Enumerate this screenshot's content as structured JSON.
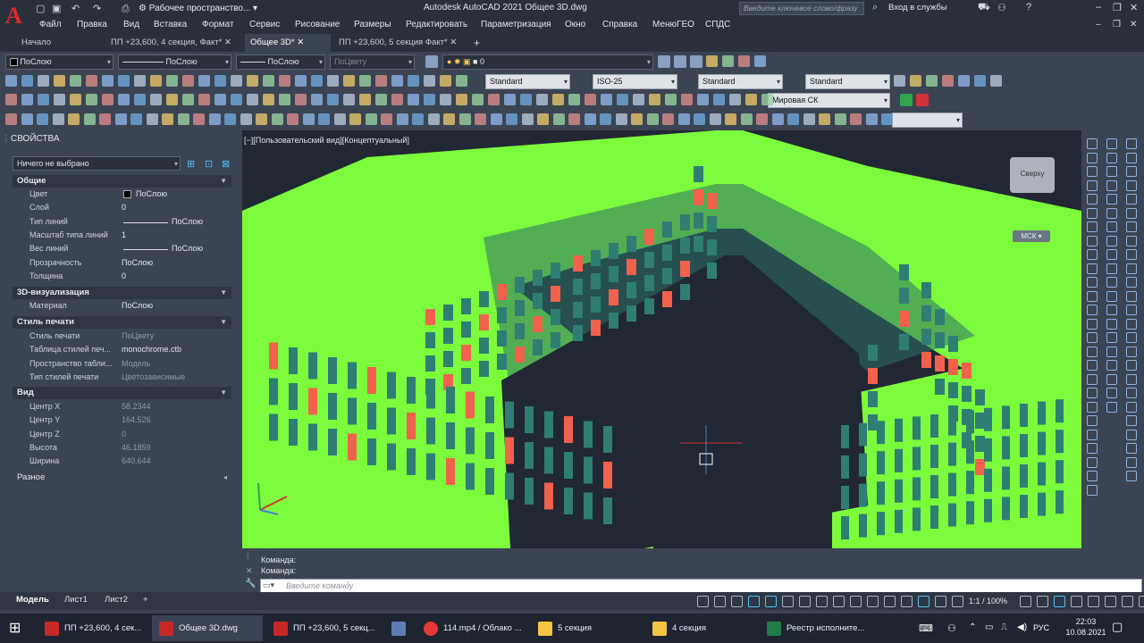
{
  "title_bar": {
    "workspace": "Рабочее пространство...",
    "app_title": "Autodesk AutoCAD 2021   Общее 3D.dwg",
    "search_placeholder": "Введите ключевое слово/фразу",
    "signin": "Вход в службы"
  },
  "menu": [
    "Файл",
    "Правка",
    "Вид",
    "Вставка",
    "Формат",
    "Сервис",
    "Рисование",
    "Размеры",
    "Редактировать",
    "Параметризация",
    "Окно",
    "Справка",
    "МенюГЕО",
    "СПДС"
  ],
  "tabs": [
    "Начало",
    "ПП +23,600, 4 секция, Факт*",
    "Общее 3D*",
    "ПП +23,600, 5 секция Факт*"
  ],
  "toolbar": {
    "color_dd": "ПоСлою",
    "linetype_dd": "ПоСлою",
    "lineweight_dd": "ПоСлою",
    "plotstyle_dd": "ПоЦвету",
    "layer_dd": "0",
    "textstyle_dd": "Standard",
    "dimstyle_dd": "ISO-25",
    "tablestyle_dd": "Standard",
    "mleaderstyle_dd": "Standard",
    "ucs_dd": "Мировая СК"
  },
  "properties": {
    "panel_title": "СВОЙСТВА",
    "selection": "Ничего не выбрано",
    "sections": {
      "general": "Общие",
      "viz3d": "3D-визуализация",
      "plot": "Стиль печати",
      "view": "Вид",
      "misc": "Разное"
    },
    "general_rows": [
      {
        "label": "Цвет",
        "value": "ПоСлою"
      },
      {
        "label": "Слой",
        "value": "0"
      },
      {
        "label": "Тип линий",
        "value": "ПоСлою"
      },
      {
        "label": "Масштаб типа линий",
        "value": "1"
      },
      {
        "label": "Вес линий",
        "value": "ПоСлою"
      },
      {
        "label": "Прозрачность",
        "value": "ПоСлою"
      },
      {
        "label": "Толщина",
        "value": "0"
      }
    ],
    "viz_rows": [
      {
        "label": "Материал",
        "value": "ПоСлою"
      }
    ],
    "plot_rows": [
      {
        "label": "Стиль печати",
        "value": "ПоЦвету"
      },
      {
        "label": "Таблица стилей печ...",
        "value": "monochrome.ctb"
      },
      {
        "label": "Пространство табли...",
        "value": "Модель"
      },
      {
        "label": "Тип стилей печати",
        "value": "Цветозависимые"
      }
    ],
    "view_rows": [
      {
        "label": "Центр X",
        "value": "58.2344"
      },
      {
        "label": "Центр Y",
        "value": "164.526"
      },
      {
        "label": "Центр Z",
        "value": "0"
      },
      {
        "label": "Высота",
        "value": "46.1859"
      },
      {
        "label": "Ширина",
        "value": "640.644"
      }
    ]
  },
  "viewport": {
    "label": "[−][Пользовательский вид][Концептуальный]",
    "viewcube_label": "Сверху",
    "ucs_label": "МСК"
  },
  "command": {
    "line1": "Команда:",
    "line2": "Команда:",
    "placeholder": "Введите команду"
  },
  "layout_tabs": [
    "Модель",
    "Лист1",
    "Лист2"
  ],
  "status": {
    "scale": "1:1 / 100%"
  },
  "taskbar": {
    "items": [
      "ПП +23,600, 4 сек...",
      "Общее 3D.dwg",
      "ПП +23,600, 5 секц...",
      "114.mp4 / Облако ...",
      "5 секция",
      "4 секция",
      "Реестр исполните..."
    ],
    "lang": "РУС",
    "time": "22:03",
    "date": "10.08.2021"
  },
  "colors": {
    "building_green": "#7cfb3c",
    "window_red": "#f2614c",
    "window_teal": "#2f7e73",
    "accent": "#e02a2a"
  }
}
